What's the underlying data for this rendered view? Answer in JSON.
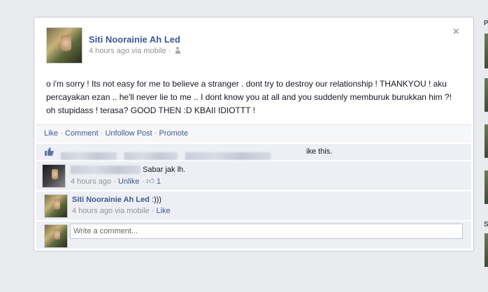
{
  "post": {
    "author": "Siti Noorainie Ah Led",
    "time": "4 hours ago via mobile",
    "time_sep": "·",
    "close_label": "×",
    "text": "o i'm sorry ! Its not easy for me to believe a stranger . dont try to destroy our relationship ! THANKYOU ! aku percayakan ezan .. he'll never lie to me .. I dont know you at all and you suddenly memburuk burukkan him ?! oh stupidass ! terasa? GOOD THEN :D KBAII IDIOTTT !"
  },
  "actions": {
    "like": "Like",
    "comment": "Comment",
    "unfollow": "Unfollow Post",
    "promote": "Promote",
    "sep": "·"
  },
  "likes": {
    "text": "ike this."
  },
  "comments": [
    {
      "author": "",
      "text": "Sabar jak lh.",
      "time": "4 hours ago",
      "unlike": "Unlike",
      "like_count": "1"
    },
    {
      "author": "Siti Noorainie Ah Led",
      "text": ":)))",
      "time": "4 hours ago via mobile",
      "like": "Like"
    }
  ],
  "composer": {
    "placeholder": "Write a comment..."
  },
  "right_rail": {
    "label_top": "P",
    "label_bottom": "S"
  },
  "colors": {
    "link": "#3b5998",
    "background": "#e9ebee"
  }
}
